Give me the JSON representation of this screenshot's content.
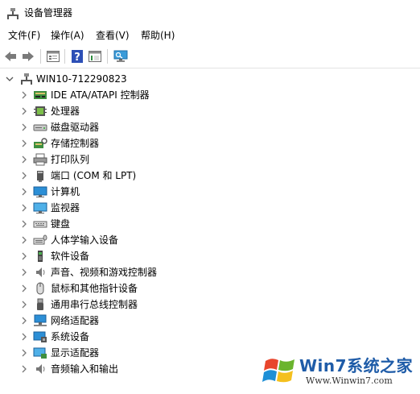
{
  "window": {
    "title": "设备管理器",
    "icon": "device-manager-icon"
  },
  "menu": [
    {
      "label": "文件(F)"
    },
    {
      "label": "操作(A)"
    },
    {
      "label": "查看(V)"
    },
    {
      "label": "帮助(H)"
    }
  ],
  "toolbar": [
    "back-arrow-icon",
    "forward-arrow-icon",
    "properties-icon",
    "help-icon",
    "show-hidden-icon",
    "monitor-scan-icon"
  ],
  "tree": {
    "root": {
      "label": "WIN10-712290823",
      "icon": "computer-network-icon",
      "expanded": true
    },
    "items": [
      {
        "label": "IDE ATA/ATAPI 控制器",
        "icon": "ide-controller-icon"
      },
      {
        "label": "处理器",
        "icon": "processor-icon"
      },
      {
        "label": "磁盘驱动器",
        "icon": "disk-drive-icon"
      },
      {
        "label": "存储控制器",
        "icon": "storage-controller-icon"
      },
      {
        "label": "打印队列",
        "icon": "printer-icon"
      },
      {
        "label": "端口 (COM 和 LPT)",
        "icon": "port-icon"
      },
      {
        "label": "计算机",
        "icon": "computer-icon"
      },
      {
        "label": "监视器",
        "icon": "monitor-icon"
      },
      {
        "label": "键盘",
        "icon": "keyboard-icon"
      },
      {
        "label": "人体学输入设备",
        "icon": "hid-icon"
      },
      {
        "label": "软件设备",
        "icon": "software-device-icon"
      },
      {
        "label": "声音、视频和游戏控制器",
        "icon": "speaker-icon"
      },
      {
        "label": "鼠标和其他指针设备",
        "icon": "mouse-icon"
      },
      {
        "label": "通用串行总线控制器",
        "icon": "usb-icon"
      },
      {
        "label": "网络适配器",
        "icon": "network-adapter-icon"
      },
      {
        "label": "系统设备",
        "icon": "system-device-icon"
      },
      {
        "label": "显示适配器",
        "icon": "display-adapter-icon"
      },
      {
        "label": "音频输入和输出",
        "icon": "audio-io-icon"
      }
    ]
  },
  "watermark": {
    "brand": "Win7系统之家",
    "url": "Www.Winwin7.com"
  }
}
